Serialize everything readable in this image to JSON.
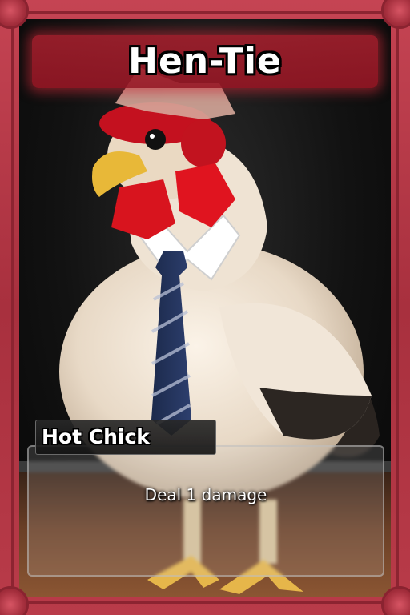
{
  "card": {
    "name": "Hen-Tie",
    "type_line": "Hot Chick",
    "ability": "Deal 1 damage",
    "colors": {
      "frame": "#b73845",
      "name_bar": "#a82030",
      "text": "#ffffff"
    },
    "art_subject": "white hen wearing a shirt collar and striped navy necktie"
  }
}
